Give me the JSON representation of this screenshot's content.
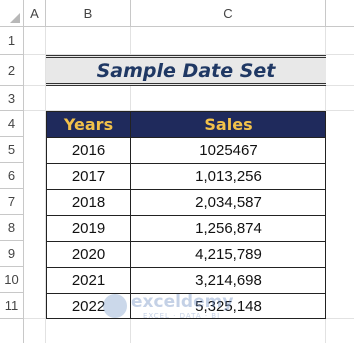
{
  "sheet": {
    "columns": [
      "A",
      "B",
      "C"
    ],
    "rows": [
      "1",
      "2",
      "3",
      "4",
      "5",
      "6",
      "7",
      "8",
      "9",
      "10",
      "11"
    ]
  },
  "title": "Sample Date Set",
  "table": {
    "headers": [
      "Years",
      "Sales"
    ],
    "rows": [
      [
        "2016",
        "1025467"
      ],
      [
        "2017",
        "1,013,256"
      ],
      [
        "2018",
        "2,034,587"
      ],
      [
        "2019",
        "1,256,874"
      ],
      [
        "2020",
        "4,215,789"
      ],
      [
        "2021",
        "3,214,698"
      ],
      [
        "2022",
        "5,325,148"
      ]
    ]
  },
  "watermark": {
    "brand": "exceldemy",
    "tagline": "EXCEL · DATA · BI"
  },
  "colors": {
    "header_bg": "#1f2a5c",
    "header_text": "#f2c14a",
    "title_text": "#1f3864",
    "title_bg": "#e8e8e8"
  }
}
